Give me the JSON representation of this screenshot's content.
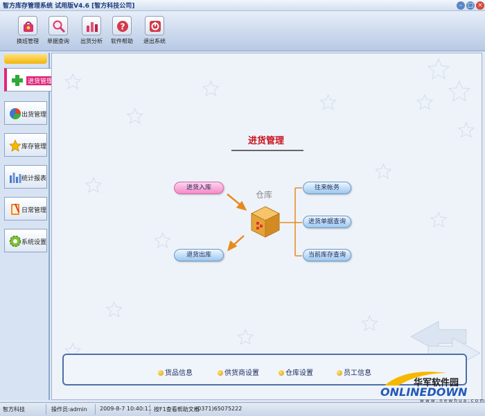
{
  "window": {
    "title": "智方库存管理系统 试用版V4.6 [智方科技公司]",
    "controls": {
      "minimize": "–",
      "maximize": "□",
      "close": "×"
    }
  },
  "toolbar": {
    "items": [
      {
        "label": "换班管理",
        "icon": "handbag-icon"
      },
      {
        "label": "单据查询",
        "icon": "magnifier-icon"
      },
      {
        "label": "出货分析",
        "icon": "bar-chart-icon"
      },
      {
        "label": "软件帮助",
        "icon": "help-icon"
      },
      {
        "label": "退出系统",
        "icon": "exit-icon"
      }
    ]
  },
  "sidebar": {
    "items": [
      {
        "label": "进货管理",
        "icon": "plus-icon",
        "active": true
      },
      {
        "label": "出货管理",
        "icon": "pie-chart-icon"
      },
      {
        "label": "库存管理",
        "icon": "star-icon"
      },
      {
        "label": "统计报表",
        "icon": "bar-report-icon"
      },
      {
        "label": "日常管理",
        "icon": "notebook-icon"
      },
      {
        "label": "系统设置",
        "icon": "gear-icon"
      }
    ]
  },
  "panel": {
    "title": "进货管理",
    "center_label": "仓库",
    "left_buttons": [
      "进货入库",
      "退货出库"
    ],
    "right_buttons": [
      "往来帐务",
      "进货单据查询",
      "当前库存查询"
    ]
  },
  "bottom_links": [
    "货品信息",
    "供货商设置",
    "仓库设置",
    "员工信息"
  ],
  "watermark": {
    "cn": "华军软件园",
    "en": "ONLINEDOWN",
    "url": "w w w . n e w h u a . c o m"
  },
  "statusbar": {
    "company": "智方科技",
    "operator": "操作员:admin",
    "datetime": "2009-8-7 10:40:11",
    "help_hint": "按F1查看帮助文档",
    "phone": "(0371)65075222"
  },
  "colors": {
    "accent": "#e0267b",
    "brand": "#2458b8",
    "title_red": "#c8101a"
  }
}
